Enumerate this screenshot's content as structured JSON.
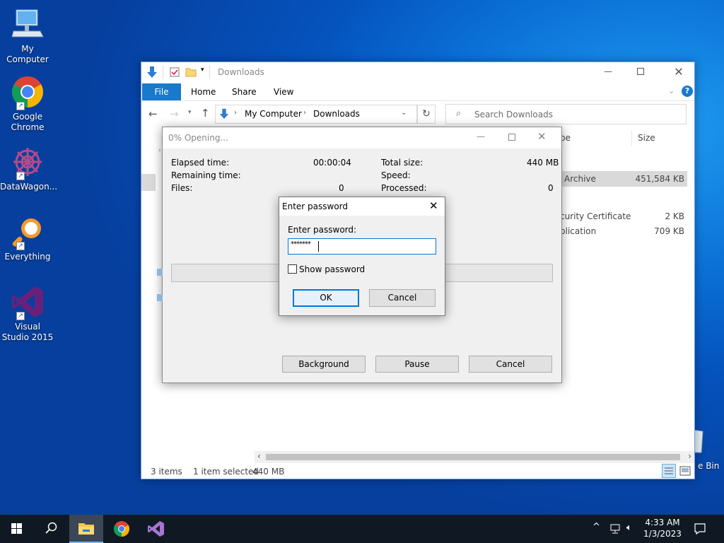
{
  "desktop": {
    "icons": [
      {
        "label": "My Computer"
      },
      {
        "label": "Google Chrome"
      },
      {
        "label": "DataWagon..."
      },
      {
        "label": "Everything"
      },
      {
        "label": "Visual Studio 2015"
      }
    ],
    "recycle_bin_label": "e Bin"
  },
  "explorer": {
    "title": "Downloads",
    "ribbon_tabs": {
      "file": "File",
      "home": "Home",
      "share": "Share",
      "view": "View"
    },
    "breadcrumb": {
      "root": "My Computer",
      "current": "Downloads"
    },
    "search_placeholder": "Search Downloads",
    "columns": {
      "type": "pe",
      "size": "Size"
    },
    "files": [
      {
        "type": "Archive",
        "size": "451,584 KB",
        "selected": true
      },
      {
        "type": "curity Certificate",
        "size": "2 KB"
      },
      {
        "type": "plication",
        "size": "709 KB"
      }
    ],
    "status": {
      "items": "3 items",
      "selected": "1 item selected",
      "size": "440 MB"
    }
  },
  "progress": {
    "title": "0% Opening...",
    "elapsed_label": "Elapsed time:",
    "elapsed_value": "00:00:04",
    "remaining_label": "Remaining time:",
    "remaining_value": "",
    "files_label": "Files:",
    "files_value": "0",
    "total_label": "Total size:",
    "total_value": "440 MB",
    "speed_label": "Speed:",
    "speed_value": "",
    "processed_label": "Processed:",
    "processed_value": "0",
    "buttons": {
      "background": "Background",
      "pause": "Pause",
      "cancel": "Cancel"
    }
  },
  "password_dialog": {
    "title": "Enter password",
    "prompt": "Enter password:",
    "value": "*******",
    "show_password": "Show password",
    "ok": "OK",
    "cancel": "Cancel"
  },
  "taskbar": {
    "time": "4:33 AM",
    "date": "1/3/2023"
  },
  "colors": {
    "accent": "#1979ca",
    "desktop": "#0a6fd6",
    "taskbar": "#101923"
  }
}
